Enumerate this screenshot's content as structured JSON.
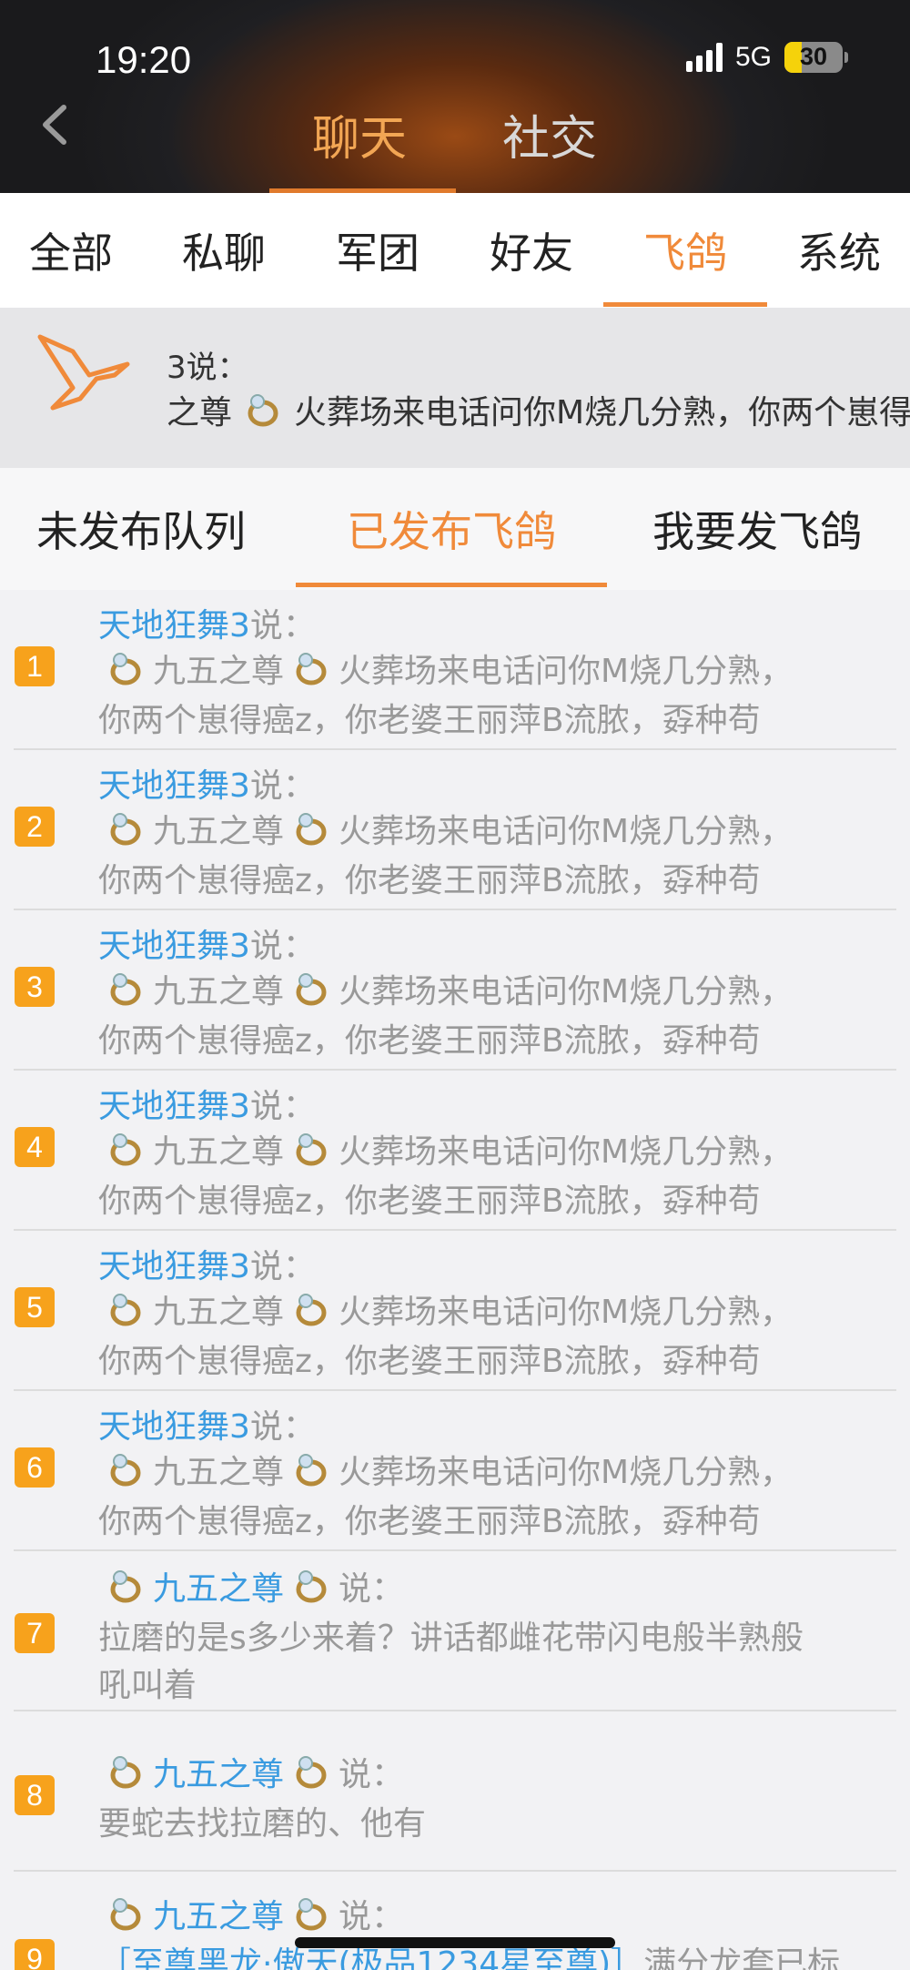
{
  "status": {
    "time": "19:20",
    "network": "5G",
    "battery": "30",
    "battery_level": 0.3
  },
  "header_tabs": [
    {
      "label": "聊天",
      "active": true
    },
    {
      "label": "社交",
      "active": false
    }
  ],
  "sub_tabs": [
    {
      "label": "全部"
    },
    {
      "label": "私聊"
    },
    {
      "label": "军团"
    },
    {
      "label": "好友"
    },
    {
      "label": "飞鸽",
      "active": true
    },
    {
      "label": "系统"
    }
  ],
  "banner": {
    "line1": "3说：",
    "name": "之尊",
    "message": "火葬场来电话问你M烧几分熟，你两个崽得癌z"
  },
  "section_tabs": [
    {
      "label": "未发布队列"
    },
    {
      "label": "已发布飞鸽",
      "active": true
    },
    {
      "label": "我要发飞鸽"
    }
  ],
  "posts": [
    {
      "no": "1",
      "author": "天地狂舞3",
      "said": "说：",
      "name": "九五之尊",
      "text1": "火葬场来电话问你M烧几分熟，",
      "text2": "你两个崽得癌z，你老婆王丽萍B流脓，孬种苟"
    },
    {
      "no": "2",
      "author": "天地狂舞3",
      "said": "说：",
      "name": "九五之尊",
      "text1": "火葬场来电话问你M烧几分熟，",
      "text2": "你两个崽得癌z，你老婆王丽萍B流脓，孬种苟"
    },
    {
      "no": "3",
      "author": "天地狂舞3",
      "said": "说：",
      "name": "九五之尊",
      "text1": "火葬场来电话问你M烧几分熟，",
      "text2": "你两个崽得癌z，你老婆王丽萍B流脓，孬种苟"
    },
    {
      "no": "4",
      "author": "天地狂舞3",
      "said": "说：",
      "name": "九五之尊",
      "text1": "火葬场来电话问你M烧几分熟，",
      "text2": "你两个崽得癌z，你老婆王丽萍B流脓，孬种苟"
    },
    {
      "no": "5",
      "author": "天地狂舞3",
      "said": "说：",
      "name": "九五之尊",
      "text1": "火葬场来电话问你M烧几分熟，",
      "text2": "你两个崽得癌z，你老婆王丽萍B流脓，孬种苟"
    },
    {
      "no": "6",
      "author": "天地狂舞3",
      "said": "说：",
      "name": "九五之尊",
      "text1": "火葬场来电话问你M烧几分熟，",
      "text2": "你两个崽得癌z，你老婆王丽萍B流脓，孬种苟"
    }
  ],
  "post7": {
    "no": "7",
    "name": "九五之尊",
    "said": "说：",
    "text1": "拉磨的是s多少来着？讲话都雌花带闪电般半熟般",
    "text2": "吼叫着"
  },
  "post8": {
    "no": "8",
    "name": "九五之尊",
    "said": "说：",
    "text1": "要蛇去找拉磨的、他有"
  },
  "post9": {
    "no": "9",
    "name": "九五之尊",
    "said": "说：",
    "item": "［至尊黑龙·傲天(极品1234星至尊)］",
    "text1": "满分龙套已标"
  }
}
